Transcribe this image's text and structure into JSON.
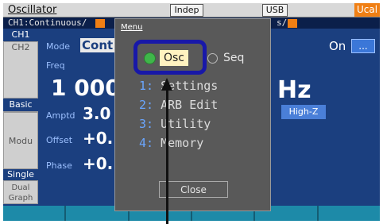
{
  "titlebar": {
    "title": "Oscillator",
    "indep": "Indep",
    "usb": "USB",
    "ucal": "Ucal"
  },
  "status": {
    "left": "CH1:Continuous/",
    "right": "s/"
  },
  "tabs": {
    "ch1": "CH1",
    "ch2": "CH2",
    "basic": "Basic",
    "modu": "Modu",
    "single": "Single",
    "dual": "Dual\nGraph"
  },
  "params": {
    "mode_label": "Mode",
    "mode_value": "Cont",
    "on_label": "On",
    "more_button": "...",
    "freq_label": "Freq",
    "freq_value": "1 000",
    "freq_unit": "Hz",
    "amptd_label": "Amptd",
    "amptd_value": "3.0",
    "load_value": "High-Z",
    "offset_label": "Offset",
    "offset_value": "+0.",
    "phase_label": "Phase",
    "phase_value": "+0."
  },
  "menu": {
    "title": "Menu",
    "osc_label": "Osc",
    "seq_label": "Seq",
    "items": [
      {
        "num": "1:",
        "label": "Settings"
      },
      {
        "num": "2:",
        "label": "ARB Edit"
      },
      {
        "num": "3:",
        "label": "Utility"
      },
      {
        "num": "4:",
        "label": "Memory"
      }
    ],
    "close_label": "Close"
  },
  "colors": {
    "screen_bg": "#1b3f7f",
    "menu_bg": "#595959",
    "accent_orange": "#f07f14",
    "highlight": "#1818a8",
    "selected_dot": "#3fb64a"
  }
}
